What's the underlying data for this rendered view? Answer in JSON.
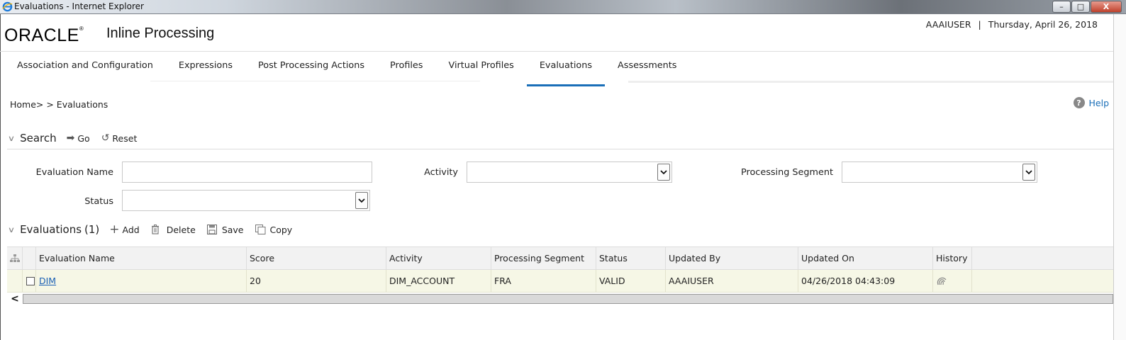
{
  "window": {
    "title": "Evaluations - Internet Explorer",
    "minimize": "–",
    "maximize": "□",
    "close": "X"
  },
  "header": {
    "logo": "ORACLE",
    "logo_mark": "®",
    "app_name": "Inline Processing",
    "user": "AAAIUSER",
    "separator": "|",
    "date": "Thursday, April 26, 2018"
  },
  "tabs": [
    {
      "label": "Association and Configuration",
      "active": false
    },
    {
      "label": "Expressions",
      "active": false
    },
    {
      "label": "Post Processing Actions",
      "active": false
    },
    {
      "label": "Profiles",
      "active": false
    },
    {
      "label": "Virtual Profiles",
      "active": false
    },
    {
      "label": "Evaluations",
      "active": true
    },
    {
      "label": "Assessments",
      "active": false
    }
  ],
  "breadcrumb": "Home> > Evaluations",
  "help": {
    "label": "Help",
    "glyph": "?"
  },
  "search": {
    "title": "Search",
    "go_label": "Go",
    "reset_label": "Reset",
    "evaluation_name_label": "Evaluation Name",
    "evaluation_name_value": "",
    "activity_label": "Activity",
    "activity_value": "",
    "processing_segment_label": "Processing Segment",
    "processing_segment_value": "",
    "status_label": "Status",
    "status_value": ""
  },
  "evaluations": {
    "title": "Evaluations",
    "count": "(1)",
    "add_label": "Add",
    "delete_label": "Delete",
    "save_label": "Save",
    "copy_label": "Copy",
    "columns": [
      "Evaluation Name",
      "Score",
      "Activity",
      "Processing Segment",
      "Status",
      "Updated By",
      "Updated On",
      "History"
    ],
    "rows": [
      {
        "evaluation_name": "DIM",
        "score": "20",
        "activity": "DIM_ACCOUNT",
        "processing_segment": "FRA",
        "status": "VALID",
        "updated_by": "AAAIUSER",
        "updated_on": "04/26/2018 04:43:09",
        "history_icon": "history-icon"
      }
    ]
  },
  "colors": {
    "accent": "#1a6fb8",
    "row_bg": "#f6f7e6",
    "header_bg": "#f2f2f2"
  }
}
